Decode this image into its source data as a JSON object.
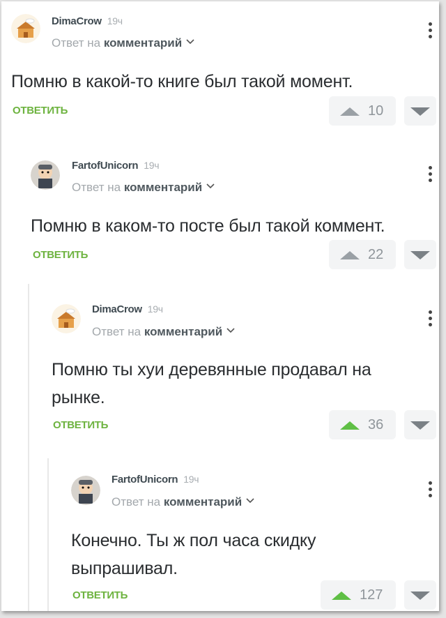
{
  "comments": [
    {
      "author": "DimaCrow",
      "time": "19ч",
      "reply_prefix": "Ответ на",
      "reply_link": "комментарий",
      "text": "Помню в какой-то книге был такой момент.",
      "reply_label": "ОТВЕТИТЬ",
      "votes": "10",
      "avatar": "house-avatar"
    },
    {
      "author": "FartofUnicorn",
      "time": "19ч",
      "reply_prefix": "Ответ на",
      "reply_link": "комментарий",
      "text": "Помню в каком-то посте был такой коммент.",
      "reply_label": "ОТВЕТИТЬ",
      "votes": "22",
      "avatar": "cartoon-kid-avatar"
    },
    {
      "author": "DimaCrow",
      "time": "19ч",
      "reply_prefix": "Ответ на",
      "reply_link": "комментарий",
      "text_line1": "Помню ты хуи деревянные продавал на",
      "text_line2": "рынке.",
      "reply_label": "ОТВЕТИТЬ",
      "votes": "36",
      "avatar": "house-avatar"
    },
    {
      "author": "FartofUnicorn",
      "time": "19ч",
      "reply_prefix": "Ответ на",
      "reply_link": "комментарий",
      "text_line1": "Конечно. Ты ж пол часа скидку",
      "text_line2": "выпрашивал.",
      "reply_label": "ОТВЕТИТЬ",
      "votes": "127",
      "avatar": "cartoon-kid-avatar"
    }
  ],
  "colors": {
    "accent_green": "#6db33f",
    "upvoted_green": "#5fbf45",
    "vote_bg": "#f3f4f5",
    "text_dark": "#2a2d30"
  }
}
